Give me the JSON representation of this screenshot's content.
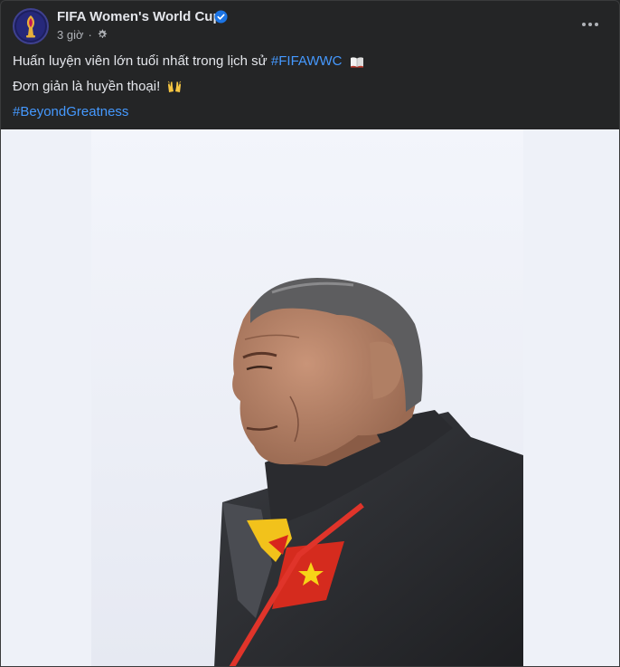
{
  "post": {
    "page_name": "FIFA Women's World Cup",
    "verified": true,
    "time": "3 giờ",
    "separator": "·",
    "privacy_icon": "settings-gear-icon",
    "more_icon": "more-options-icon",
    "caption": {
      "line1_text": "Huấn luyện viên lớn tuổi nhất trong lịch sử",
      "line1_hashtag": "#FIFAWWC",
      "line1_emoji": "open-book-emoji",
      "line2_text": "Đơn giản là huyền thoại!",
      "line2_emoji": "raised-hands-emoji",
      "line3_hashtag": "#BeyondGreatness"
    },
    "photo": {
      "subject": "coach-portrait-photo"
    }
  },
  "colors": {
    "background": "#242526",
    "primary_text": "#e4e6eb",
    "secondary_text": "#b0b3b8",
    "link": "#4599ff",
    "verified_badge": "#1b74e4"
  }
}
